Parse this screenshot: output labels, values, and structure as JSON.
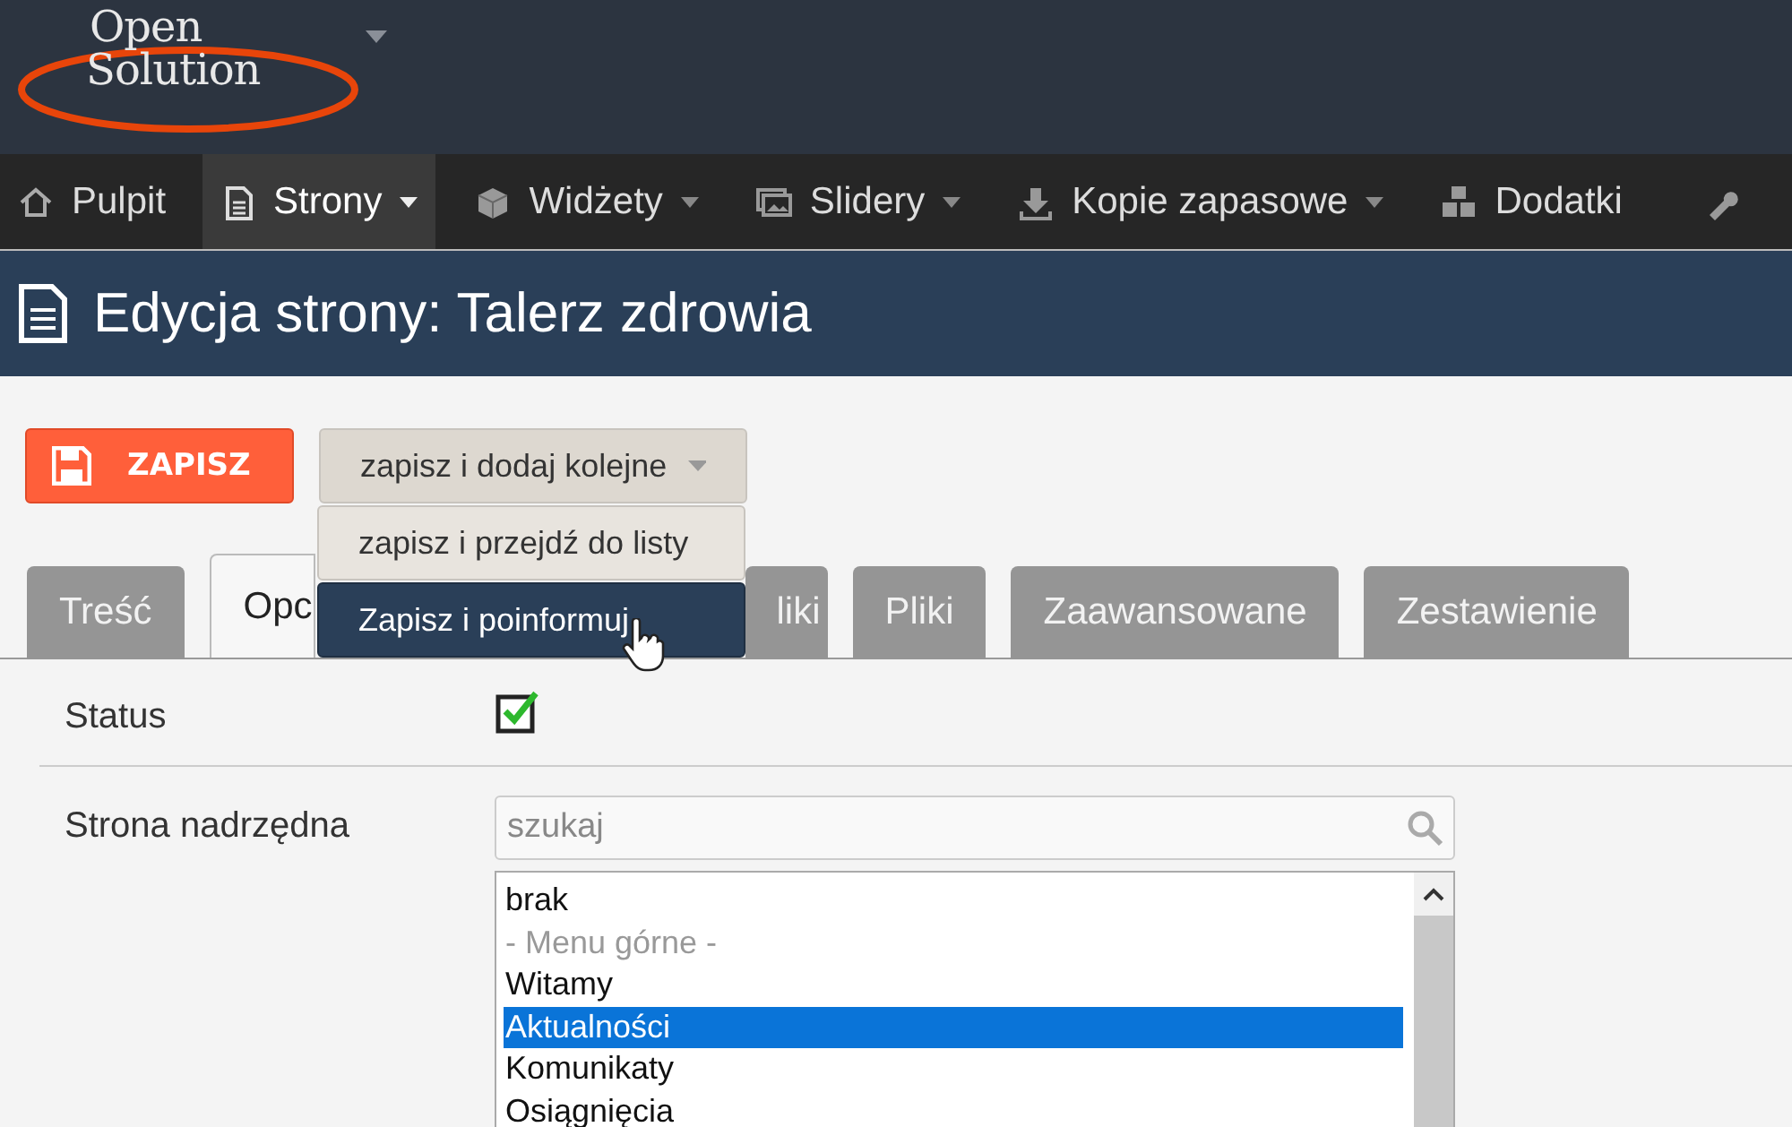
{
  "logo": {
    "lines": [
      "Open",
      "Solution"
    ]
  },
  "nav": [
    {
      "label": "Pulpit",
      "selected": false,
      "caret": false
    },
    {
      "label": "Strony",
      "selected": true,
      "caret": true
    },
    {
      "label": "Widżety",
      "selected": false,
      "caret": true
    },
    {
      "label": "Slidery",
      "selected": false,
      "caret": true
    },
    {
      "label": "Kopie zapasowe",
      "selected": false,
      "caret": true
    },
    {
      "label": "Dodatki",
      "selected": false,
      "caret": false
    }
  ],
  "page_title": "Edycja strony: Talerz zdrowia",
  "save_button": "ZAPISZ",
  "save_menu": {
    "label": "zapisz i dodaj kolejne",
    "expanded": true,
    "items": [
      {
        "label": "zapisz i przejdź do listy",
        "selected": false
      },
      {
        "label": "Zapisz i poinformuj",
        "selected": true
      }
    ]
  },
  "tabs": [
    {
      "label": "Treść",
      "selected": false
    },
    {
      "label": "Opc",
      "selected": true
    },
    {
      "label": "liki",
      "selected": false
    },
    {
      "label": "Pliki",
      "selected": false
    },
    {
      "label": "Zaawansowane",
      "selected": false
    },
    {
      "label": "Zestawienie",
      "selected": false
    }
  ],
  "form": {
    "status": {
      "label": "Status",
      "checked": true
    },
    "parent": {
      "label": "Strona nadrzędna",
      "placeholder": "szukaj",
      "options": [
        {
          "label": "brak",
          "kind": "option",
          "selected": false
        },
        {
          "label": "- Menu górne -",
          "kind": "group",
          "selected": false
        },
        {
          "label": "Witamy",
          "kind": "option",
          "selected": false
        },
        {
          "label": "Aktualności",
          "kind": "option",
          "selected": true
        },
        {
          "label": "Komunikaty",
          "kind": "option",
          "selected": false
        },
        {
          "label": "Osiągnięcia",
          "kind": "option",
          "selected": false
        }
      ]
    }
  }
}
